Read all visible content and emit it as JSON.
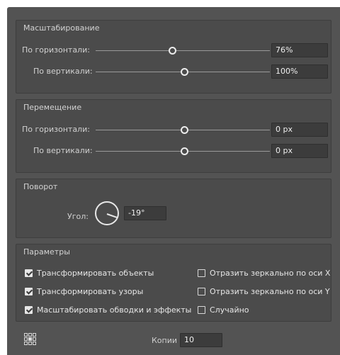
{
  "scale": {
    "title": "Масштабирование",
    "horizontal": {
      "label": "По горизонтали:",
      "value": "76%",
      "slider": 0.44
    },
    "vertical": {
      "label": "По вертикали:",
      "value": "100%",
      "slider": 0.51
    }
  },
  "move": {
    "title": "Перемещение",
    "horizontal": {
      "label": "По горизонтали:",
      "value": "0 px",
      "slider": 0.51
    },
    "vertical": {
      "label": "По вертикали:",
      "value": "0 px",
      "slider": 0.51
    }
  },
  "rotate": {
    "title": "Поворот",
    "angle_label": "Угол:",
    "angle_value": "-19°",
    "angle_degrees": -19
  },
  "options": {
    "title": "Параметры",
    "transform_objects": {
      "label": "Трансформировать объекты",
      "checked": true
    },
    "transform_patterns": {
      "label": "Трансформировать узоры",
      "checked": true
    },
    "scale_strokes": {
      "label": "Масштабировать обводки и эффекты",
      "checked": true
    },
    "reflect_x": {
      "label": "Отразить зеркально по оси X",
      "checked": false
    },
    "reflect_y": {
      "label": "Отразить зеркально по оси Y",
      "checked": false
    },
    "random": {
      "label": "Случайно",
      "checked": false
    }
  },
  "copies": {
    "label": "Копии",
    "value": "10"
  },
  "icons": {
    "reference_point": "reference-point-grid-icon"
  }
}
